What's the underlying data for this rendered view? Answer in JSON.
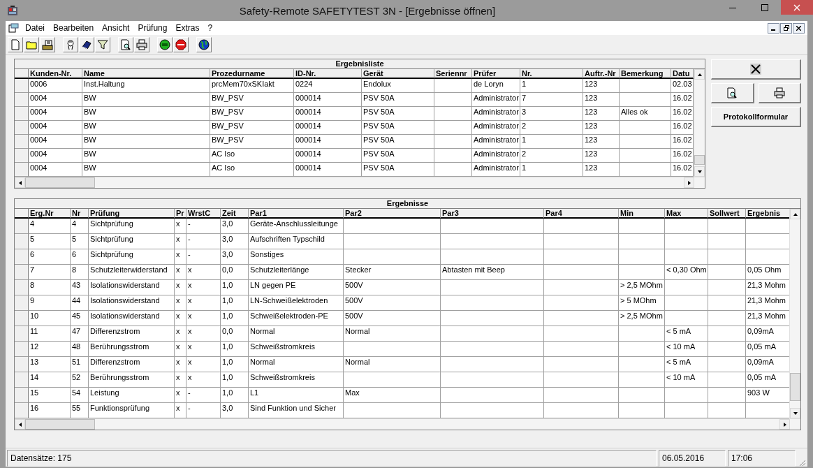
{
  "window": {
    "title": "Safety-Remote SAFETYTEST 3N - [Ergebnisse öffnen]"
  },
  "menu": [
    "Datei",
    "Bearbeiten",
    "Ansicht",
    "Prüfung",
    "Extras",
    "?"
  ],
  "result_list": {
    "title": "Ergebnisliste",
    "columns": [
      "Kunden-Nr.",
      "Name",
      "Prozedurname",
      "ID-Nr.",
      "Gerät",
      "Seriennr",
      "Prüfer",
      "Nr.",
      "Auftr.-Nr",
      "Bemerkung",
      "Datu"
    ],
    "rows": [
      [
        "0006",
        "Inst.Haltung",
        "prcMem70xSKIakt",
        "0224",
        "Endolux",
        null,
        "de Loryn",
        "1",
        "123",
        null,
        "02.03"
      ],
      [
        "0004",
        "BW",
        "BW_PSV",
        "000014",
        "PSV 50A",
        null,
        "Administrator",
        "7",
        "123",
        null,
        "16.02"
      ],
      [
        "0004",
        "BW",
        "BW_PSV",
        "000014",
        "PSV 50A",
        null,
        "Administrator",
        "3",
        "123",
        "Alles ok",
        "16.02"
      ],
      [
        "0004",
        "BW",
        "BW_PSV",
        "000014",
        "PSV 50A",
        null,
        "Administrator",
        "2",
        "123",
        null,
        "16.02"
      ],
      [
        "0004",
        "BW",
        "BW_PSV",
        "000014",
        "PSV 50A",
        null,
        "Administrator",
        "1",
        "123",
        null,
        "16.02"
      ],
      [
        "0004",
        "BW",
        "AC Iso",
        "000014",
        "PSV 50A",
        null,
        "Administrator",
        "2",
        "123",
        null,
        "16.02"
      ],
      [
        "0004",
        "BW",
        "AC Iso",
        "000014",
        "PSV 50A",
        null,
        "Administrator",
        "1",
        "123",
        null,
        "16.02"
      ]
    ]
  },
  "side_buttons": {
    "report_form": "Protokollformular"
  },
  "results": {
    "title": "Ergebnisse",
    "columns": [
      "Erg.Nr",
      "Nr",
      "Prüfung",
      "Pr",
      "WrstC",
      "Zeit",
      "Par1",
      "Par2",
      "Par3",
      "Par4",
      "Min",
      "Max",
      "Sollwert",
      "Ergebnis"
    ],
    "rows": [
      [
        "4",
        "4",
        "Sichtprüfung",
        "x",
        "-",
        "3,0",
        "Geräte-Anschlussleitunge",
        null,
        null,
        null,
        null,
        null,
        null,
        null
      ],
      [
        "5",
        "5",
        "Sichtprüfung",
        "x",
        "-",
        "3,0",
        "Aufschriften Typschild",
        null,
        null,
        null,
        null,
        null,
        null,
        null
      ],
      [
        "6",
        "6",
        "Sichtprüfung",
        "x",
        "-",
        "3,0",
        "Sonstiges",
        null,
        null,
        null,
        null,
        null,
        null,
        null
      ],
      [
        "7",
        "8",
        "Schutzleiterwiderstand",
        "x",
        "x",
        "0,0",
        "Schutzleiterlänge",
        "Stecker",
        "Abtasten mit Beep",
        null,
        null,
        "< 0,30 Ohm",
        null,
        "0,05 Ohm"
      ],
      [
        "8",
        "43",
        "Isolationswiderstand",
        "x",
        "x",
        "1,0",
        "LN gegen PE",
        "500V",
        null,
        null,
        "> 2,5 MOhm",
        null,
        null,
        "21,3 Mohm"
      ],
      [
        "9",
        "44",
        "Isolationswiderstand",
        "x",
        "x",
        "1,0",
        "LN-Schweißelektroden",
        "500V",
        null,
        null,
        "> 5 MOhm",
        null,
        null,
        "21,3 Mohm"
      ],
      [
        "10",
        "45",
        "Isolationswiderstand",
        "x",
        "x",
        "1,0",
        "Schweißelektroden-PE",
        "500V",
        null,
        null,
        "> 2,5 MOhm",
        null,
        null,
        "21,3 Mohm"
      ],
      [
        "11",
        "47",
        "Differenzstrom",
        "x",
        "x",
        "0,0",
        "Normal",
        "Normal",
        null,
        null,
        null,
        "< 5 mA",
        null,
        "0,09mA"
      ],
      [
        "12",
        "48",
        "Berührungsstrom",
        "x",
        "x",
        "1,0",
        "Schweißstromkreis",
        null,
        null,
        null,
        null,
        "< 10 mA",
        null,
        "0,05 mA"
      ],
      [
        "13",
        "51",
        "Differenzstrom",
        "x",
        "x",
        "1,0",
        "Normal",
        "Normal",
        null,
        null,
        null,
        "< 5 mA",
        null,
        "0,09mA"
      ],
      [
        "14",
        "52",
        "Berührungsstrom",
        "x",
        "x",
        "1,0",
        "Schweißstromkreis",
        null,
        null,
        null,
        null,
        "< 10 mA",
        null,
        "0,05 mA"
      ],
      [
        "15",
        "54",
        "Leistung",
        "x",
        "-",
        "1,0",
        "L1",
        "Max",
        null,
        null,
        null,
        null,
        null,
        "903 W"
      ],
      [
        "16",
        "55",
        "Funktionsprüfung",
        "x",
        "-",
        "3,0",
        "Sind Funktion und Sicher",
        null,
        null,
        null,
        null,
        null,
        null,
        null
      ]
    ]
  },
  "status_bar": {
    "records": "Datensätze: 175",
    "date": "06.05.2016",
    "time": "17:06"
  }
}
